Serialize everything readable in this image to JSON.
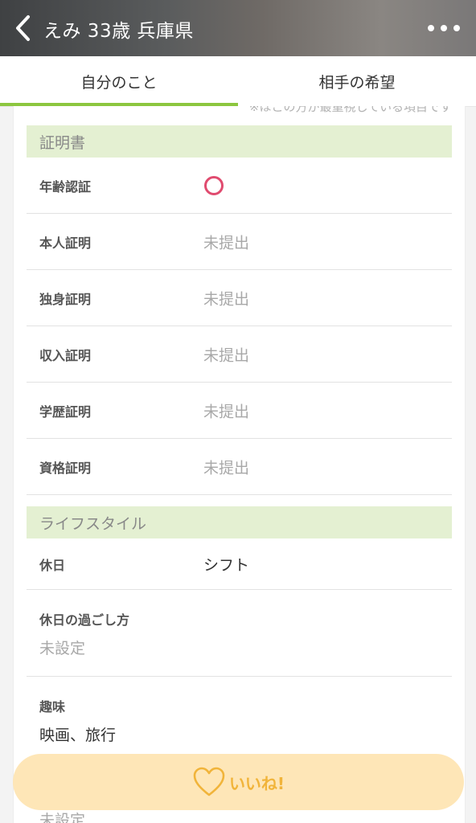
{
  "header": {
    "title": "えみ 33歳 兵庫県",
    "back_icon": "chevron-left-icon",
    "more_icon": "more-dots-icon"
  },
  "tabs": [
    {
      "label": "自分のこと",
      "active": true
    },
    {
      "label": "相手の希望",
      "active": false
    }
  ],
  "cut_off_note": "※ほこの方が最重視している項目です",
  "certificates": {
    "title": "証明書",
    "rows": [
      {
        "label": "年齢認証",
        "value": "○",
        "status_icon": "circle-verified-icon"
      },
      {
        "label": "本人証明",
        "value": "未提出"
      },
      {
        "label": "独身証明",
        "value": "未提出"
      },
      {
        "label": "収入証明",
        "value": "未提出"
      },
      {
        "label": "学歴証明",
        "value": "未提出"
      },
      {
        "label": "資格証明",
        "value": "未提出"
      }
    ]
  },
  "lifestyle": {
    "title": "ライフスタイル",
    "holiday": {
      "label": "休日",
      "value": "シフト"
    },
    "holiday_spending": {
      "label": "休日の過ごし方",
      "value": "未設定"
    },
    "hobby": {
      "label": "趣味",
      "value": "映画、旅行"
    },
    "partial_value": "未設定"
  },
  "like_button": {
    "label": "いいね!",
    "icon": "heart-outline-icon",
    "color": "#f1b43a"
  },
  "colors": {
    "accent": "#8cc63f",
    "section_bg": "#e4f0d2",
    "verified": "#e04b6f"
  }
}
